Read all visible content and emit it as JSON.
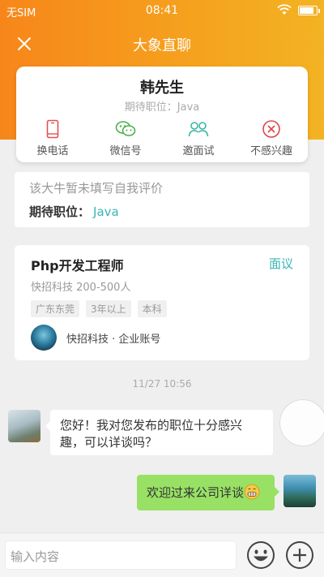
{
  "status_bar": {
    "carrier": "无SIM",
    "time": "08:41"
  },
  "nav": {
    "title": "大象直聊"
  },
  "profile": {
    "name": "韩先生",
    "expected_position": "期待职位：Java",
    "actions": [
      {
        "label": "换电话",
        "icon": "phone-icon",
        "color": "#e45252"
      },
      {
        "label": "微信号",
        "icon": "wechat-icon",
        "color": "#4cb14f"
      },
      {
        "label": "邀面试",
        "icon": "invite-interview-icon",
        "color": "#3bb6a5"
      },
      {
        "label": "不感兴趣",
        "icon": "not-interested-icon",
        "color": "#e04646"
      }
    ]
  },
  "intro": {
    "self_evaluation": "该大牛暂未填写自我评价",
    "position_label": "期待职位：",
    "position_value": "Java"
  },
  "job": {
    "title": "Php开发工程师",
    "salary": "面议",
    "company_info": "快招科技 200-500人",
    "tags": [
      "广东东莞",
      "3年以上",
      "本科"
    ],
    "company_account": "快招科技 · 企业账号"
  },
  "chat": {
    "timestamp": "11/27 10:56",
    "messages": [
      {
        "side": "left",
        "text": "您好！我对您发布的职位十分感兴趣，可以详谈吗？"
      },
      {
        "side": "right",
        "text": "欢迎过来公司详谈"
      }
    ]
  },
  "input": {
    "placeholder": "输入内容"
  },
  "colors": {
    "accent": "#f7861a",
    "teal": "#38b6b6",
    "bubble_green": "#98e165"
  }
}
